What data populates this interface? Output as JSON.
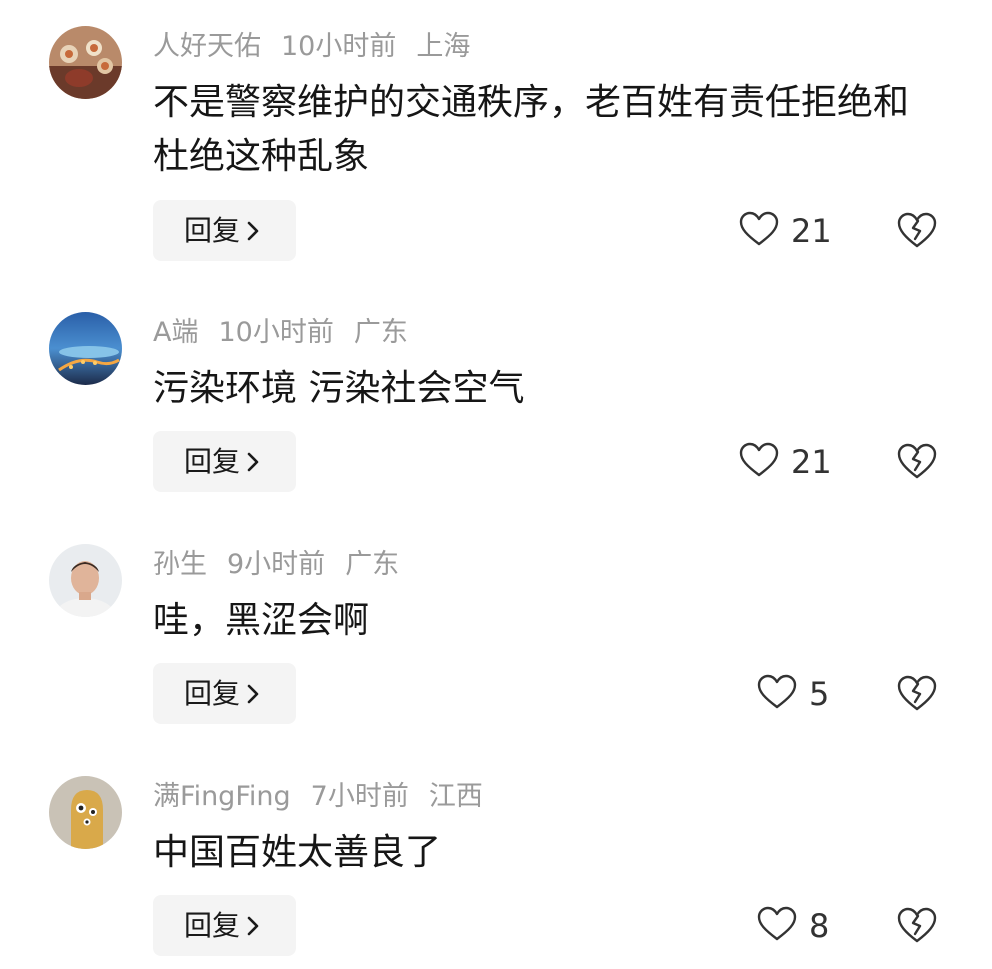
{
  "reply_label": "回复",
  "comments": [
    {
      "user": "人好天佑",
      "time": "10小时前",
      "location": "上海",
      "text": "不是警察维护的交通秩序，老百姓有责任拒绝和杜绝这种乱象",
      "likes": "21"
    },
    {
      "user": "A端",
      "time": "10小时前",
      "location": "广东",
      "text": "污染环境 污染社会空气",
      "likes": "21"
    },
    {
      "user": "孙生",
      "time": "9小时前",
      "location": "广东",
      "text": "哇，黑涩会啊",
      "likes": "5"
    },
    {
      "user": "满FingFing",
      "time": "7小时前",
      "location": "江西",
      "text": "中国百姓太善良了",
      "likes": "8"
    }
  ],
  "icons": {
    "like": "heart-outline-icon",
    "dislike": "broken-heart-icon",
    "reply_arrow": "chevron-right-icon"
  },
  "colors": {
    "meta_text": "#9a9a9a",
    "reply_bg": "#f4f4f4",
    "icon_stroke": "#333333"
  }
}
